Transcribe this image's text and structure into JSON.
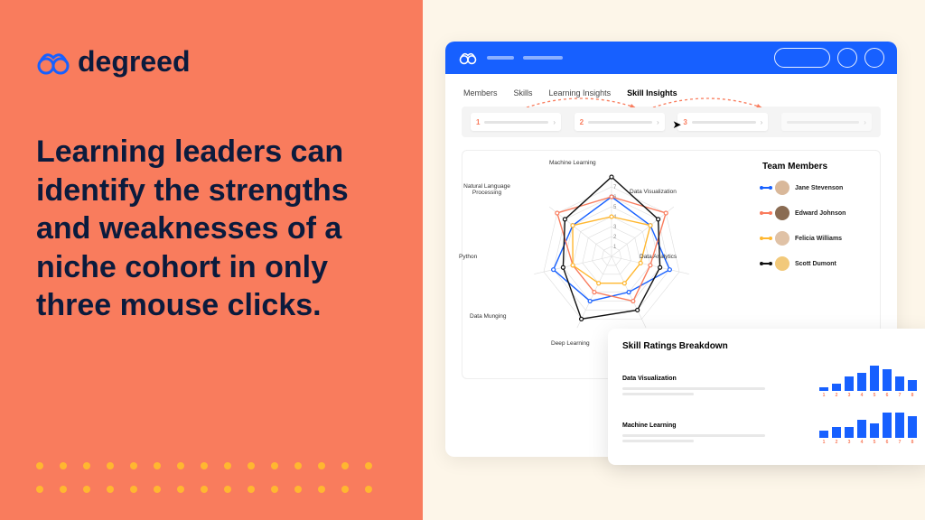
{
  "brand": {
    "name": "degreed"
  },
  "headline": "Learning leaders can identify the strengths and weaknesses of a niche cohort in only three mouse clicks.",
  "tabs": [
    "Members",
    "Skills",
    "Learning Insights",
    "Skill Insights"
  ],
  "active_tab": 3,
  "steps": [
    "1",
    "2",
    "3"
  ],
  "team": {
    "title": "Team Members",
    "members": [
      {
        "name": "Jane Stevenson",
        "color": "#1760ff",
        "avatar": "#d9b89a"
      },
      {
        "name": "Edward Johnson",
        "color": "#f97c5d",
        "avatar": "#8a6b52"
      },
      {
        "name": "Felicia Williams",
        "color": "#ffb730",
        "avatar": "#e0c2a6"
      },
      {
        "name": "Scott Dumont",
        "color": "#111",
        "avatar": "#f2c97a"
      }
    ]
  },
  "skill_breakdown": {
    "title": "Skill Ratings Breakdown",
    "skills": [
      "Data Visualization",
      "Machine Learning"
    ]
  },
  "radar_labels": {
    "top": "Machine Learning",
    "tr": "Data Visualization",
    "r": "Data Analytics",
    "br": "",
    "bottom": "Deep Learning",
    "bl": "Data Munging",
    "l": "Python",
    "tl": "Natural Language Processing"
  },
  "radar_ticks": [
    "1",
    "2",
    "3",
    "4",
    "5",
    "6",
    "7"
  ],
  "chart_data": [
    {
      "type": "radar",
      "title": "Skill Insights",
      "categories": [
        "Machine Learning",
        "Data Visualization",
        "Data Analytics",
        "Deep Learning",
        "Data Munging",
        "Python",
        "Natural Language Processing"
      ],
      "max": 8,
      "ticks": [
        1,
        2,
        3,
        4,
        5,
        6,
        7
      ],
      "series": [
        {
          "name": "Jane Stevenson",
          "color": "#1760ff",
          "values": [
            6,
            5,
            6,
            4,
            5,
            6,
            5
          ]
        },
        {
          "name": "Edward Johnson",
          "color": "#f97c5d",
          "values": [
            6,
            7,
            4,
            5,
            4,
            4,
            7
          ]
        },
        {
          "name": "Felicia Williams",
          "color": "#ffb730",
          "values": [
            4,
            5,
            3,
            3,
            3,
            4,
            5
          ]
        },
        {
          "name": "Scott Dumont",
          "color": "#111111",
          "values": [
            8,
            6,
            5,
            6,
            7,
            5,
            6
          ]
        }
      ]
    },
    {
      "type": "bar",
      "title": "Data Visualization",
      "categories": [
        "1",
        "2",
        "3",
        "4",
        "5",
        "6",
        "7",
        "8"
      ],
      "values": [
        1,
        2,
        4,
        5,
        7,
        6,
        4,
        3
      ],
      "ylim": [
        0,
        8
      ]
    },
    {
      "type": "bar",
      "title": "Machine Learning",
      "categories": [
        "1",
        "2",
        "3",
        "4",
        "5",
        "6",
        "7",
        "8"
      ],
      "values": [
        2,
        3,
        3,
        5,
        4,
        7,
        7,
        6
      ],
      "ylim": [
        0,
        8
      ]
    }
  ]
}
